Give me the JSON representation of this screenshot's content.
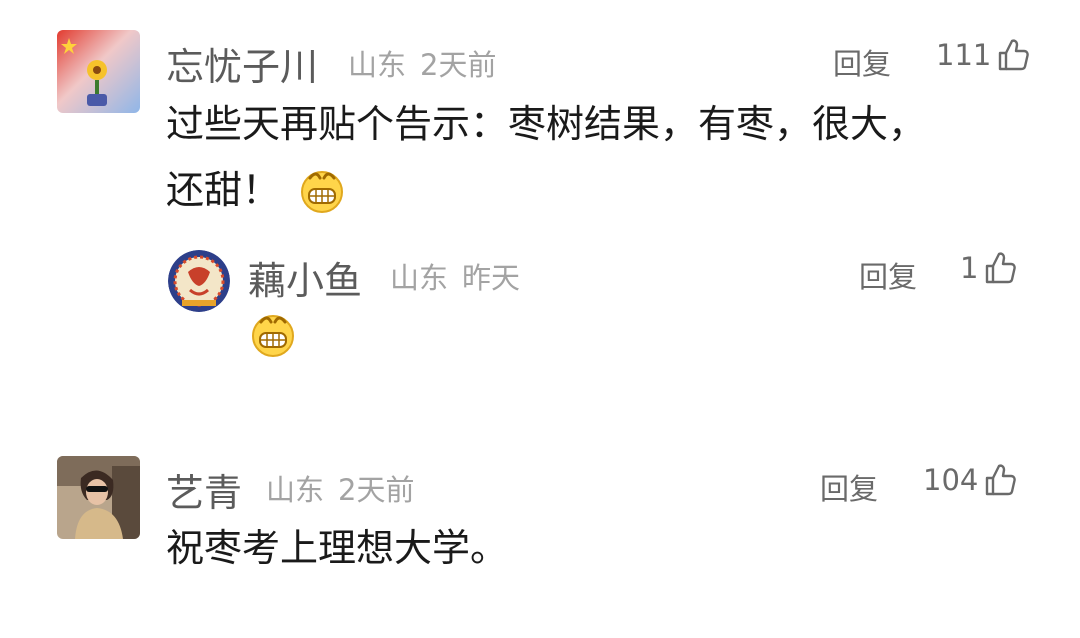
{
  "comments": [
    {
      "username": "忘忧子川",
      "location": "山东",
      "time": "2天前",
      "reply_label": "回复",
      "likes": "111",
      "text_line1": "过些天再贴个告示：枣树结果，有枣，很大，",
      "text_line2": "还甜！",
      "emoji": "grinning-face"
    },
    {
      "username": "藕小鱼",
      "location": "山东",
      "time": "昨天",
      "reply_label": "回复",
      "likes": "1",
      "emoji": "grinning-face"
    },
    {
      "username": "艺青",
      "location": "山东",
      "time": "2天前",
      "reply_label": "回复",
      "likes": "104",
      "text_line1": "祝枣考上理想大学。"
    }
  ],
  "colors": {
    "username": "#5b5b5b",
    "meta": "#a3a3a3",
    "action": "#6a6a6a",
    "text": "#1a1a1a"
  }
}
